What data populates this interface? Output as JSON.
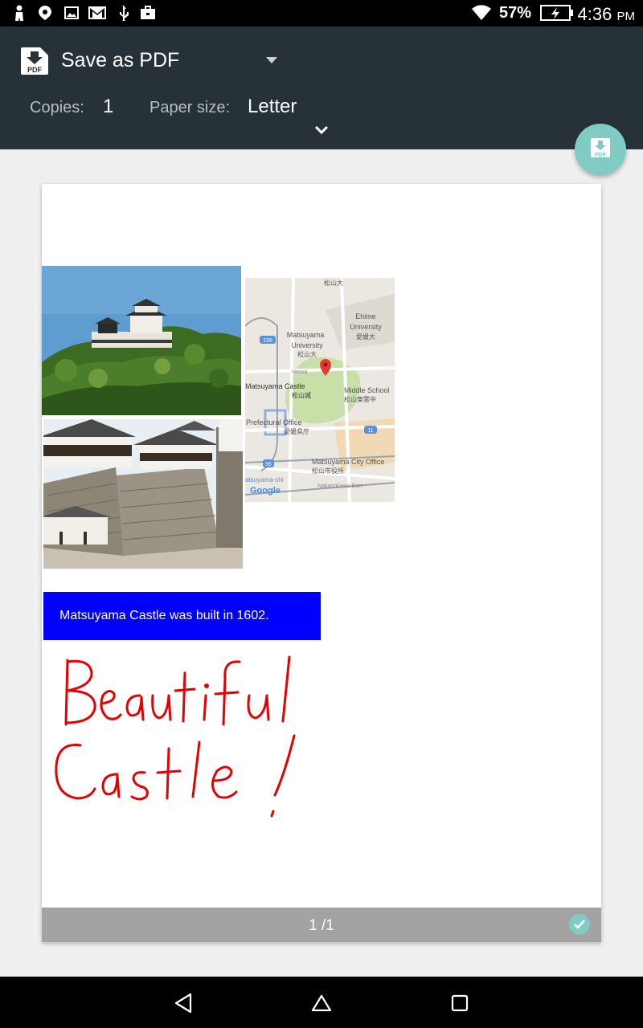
{
  "status_bar": {
    "battery_percent": "57%",
    "time": "4:36",
    "ampm": "PM"
  },
  "print_header": {
    "destination": "Save as PDF",
    "copies_label": "Copies:",
    "copies_value": "1",
    "paper_size_label": "Paper size:",
    "paper_size_value": "Letter"
  },
  "preview": {
    "caption": "Matsuyama Castle was built in 1602.",
    "handwriting_line1": "Beautiful",
    "handwriting_line2": "Castle!",
    "page_indicator": "1 /1",
    "map_labels": {
      "l1": "松山大",
      "l2": "Ehime",
      "l3": "University",
      "l4": "愛媛大",
      "l5": "Matsuyama",
      "l6": "University",
      "l7": "松山大",
      "l8": "Heiwa",
      "l9": "Matsuyama Castle",
      "l10": "松山城",
      "l11": "Middle School",
      "l12": "松山東雲中",
      "l13": "Prefectural Office",
      "l14": "愛媛県庁",
      "l15": "Matsuyama City Office",
      "l16": "松山市役所",
      "l17": "atsuyama-shi",
      "l18": "Nakanokawa Dori",
      "l19": "Google",
      "r196": "196",
      "r11": "11",
      "r56": "56"
    }
  },
  "colors": {
    "header_bg": "#263238",
    "fab": "#80cbc4",
    "caption_bg": "#0000ff",
    "handwriting": "#e60000"
  },
  "icons": [
    "person-icon",
    "map-pin-icon",
    "image-icon",
    "gmail-icon",
    "usb-icon",
    "briefcase-icon",
    "wifi-icon",
    "battery-charging-icon",
    "pdf-file-icon",
    "dropdown-caret-icon",
    "chevron-down-icon",
    "download-pdf-icon",
    "check-icon",
    "back-icon",
    "home-icon",
    "recents-icon"
  ]
}
